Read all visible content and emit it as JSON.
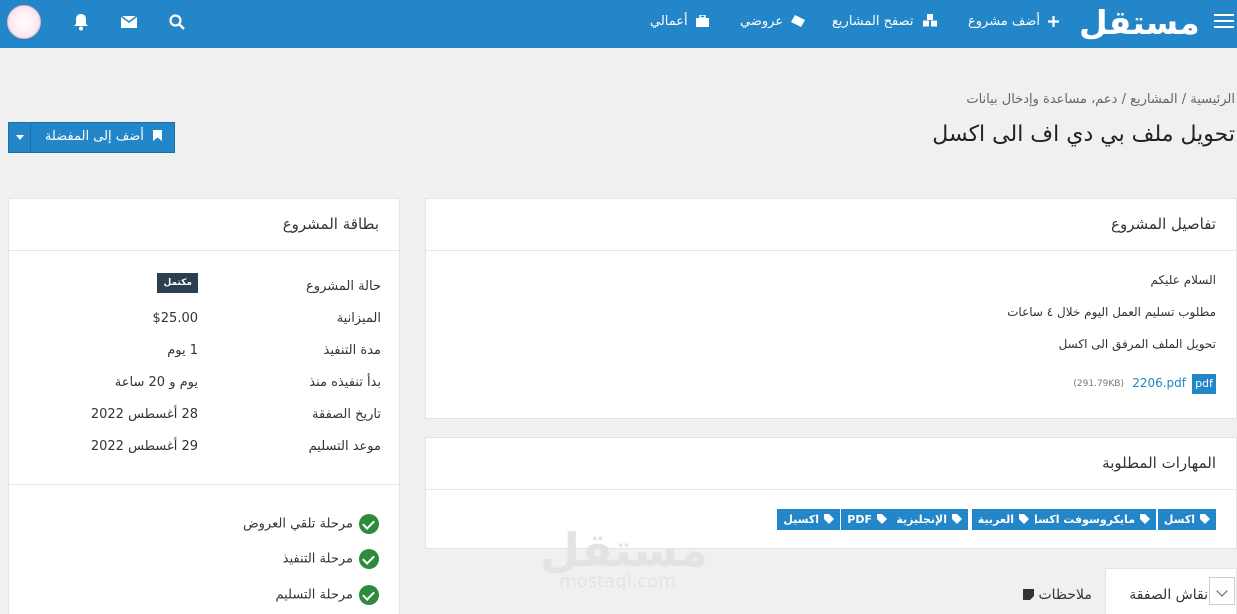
{
  "topbar": {
    "logo": "مستقل",
    "nav": [
      {
        "label": "أضف مشروع",
        "icon": "plus-icon"
      },
      {
        "label": "تصفح المشاريع",
        "icon": "cubes-icon"
      },
      {
        "label": "عروضي",
        "icon": "ticket-icon"
      },
      {
        "label": "أعمالي",
        "icon": "briefcase-icon"
      }
    ],
    "icons": [
      "search-icon",
      "envelope-icon",
      "bell-icon",
      "avatar"
    ],
    "color": "#2386c8"
  },
  "breadcrumb": "الرئيسية / المشاريع / دعم، مساعدة وإدخال بيانات",
  "page_title": "تحويل ملف بي دي اف الى اكسل",
  "favorite_button": "أضف إلى المفضلة",
  "details": {
    "title": "تفاصيل المشروع",
    "lines": [
      "السلام عليكم",
      "مطلوب تسليم العمل اليوم خلال ٤ ساعات",
      "تحويل الملف المرفق الى اكسل"
    ],
    "attachment": {
      "badge": "pdf",
      "name": "2206.pdf",
      "size": "(291.79KB)"
    }
  },
  "skills": {
    "title": "المهارات المطلوبة",
    "tags": [
      "اكسل",
      "مايكروسوفت اكسل",
      "العربية",
      "الإنجليزية",
      "PDF",
      "اكسيل"
    ]
  },
  "project_card": {
    "title": "بطاقة المشروع",
    "status_label": "حالة المشروع",
    "status_value": "مكتمل",
    "rows": [
      {
        "key": "الميزانية",
        "value": "$25.00"
      },
      {
        "key": "مدة التنفيذ",
        "value": "1 يوم"
      },
      {
        "key": "بدأ تنفيذه منذ",
        "value": "يوم و 20 ساعة"
      },
      {
        "key": "تاريخ الصفقة",
        "value": "28 أغسطس 2022"
      },
      {
        "key": "موعد التسليم",
        "value": "29 أغسطس 2022"
      }
    ],
    "stages": [
      "مرحلة تلقي العروض",
      "مرحلة التنفيذ",
      "مرحلة التسليم"
    ]
  },
  "tabs": {
    "active": "نقاش الصفقة",
    "other": "ملاحظات"
  },
  "watermark": {
    "ar": "مستقل",
    "en": "mostaql.com"
  }
}
